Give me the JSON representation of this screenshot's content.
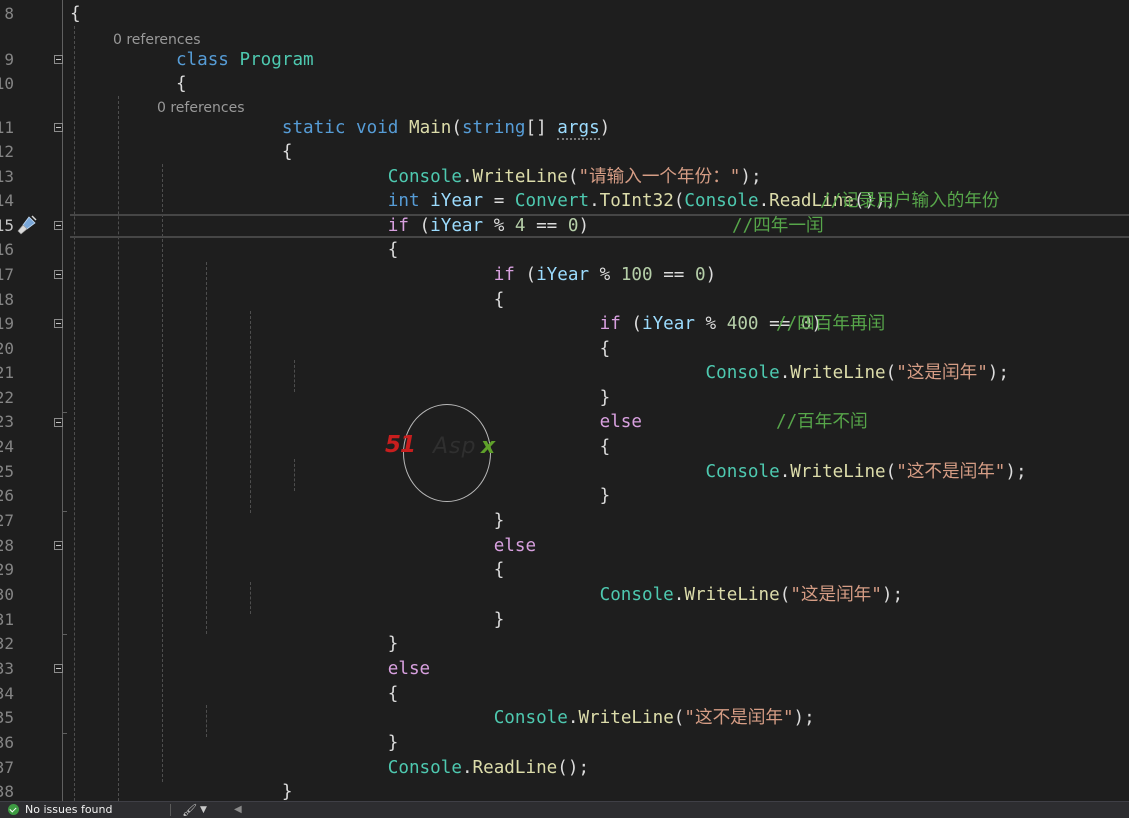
{
  "editor": {
    "current_line": "15",
    "line_numbers": [
      "8",
      "9",
      "10",
      "11",
      "12",
      "13",
      "14",
      "15",
      "16",
      "17",
      "18",
      "19",
      "20",
      "21",
      "22",
      "23",
      "24",
      "25",
      "26",
      "27",
      "28",
      "29",
      "30",
      "31",
      "32",
      "33",
      "34",
      "35",
      "36",
      "37",
      "38"
    ],
    "codelens": [
      "0 references",
      "0 references"
    ],
    "code": {
      "l8_brace": "{",
      "l9_kw": "class",
      "l9_name": "Program",
      "l10_brace": "{",
      "l11_kw1": "static",
      "l11_kw2": "void",
      "l11_method": "Main",
      "l11_open": "(",
      "l11_type": "string",
      "l11_arr": "[] ",
      "l11_param": "args",
      "l11_close": ")",
      "l12_brace": "{",
      "l13_cls": "Console",
      "l13_dot": ".",
      "l13_method": "WriteLine",
      "l13_open": "(",
      "l13_str": "\"请输入一个年份：\"",
      "l13_close": ");",
      "l14_kw": "int",
      "l14_var": "iYear",
      "l14_eq": " = ",
      "l14_cls": "Convert",
      "l14_dot": ".",
      "l14_method": "ToInt32",
      "l14_open": "(",
      "l14_cls2": "Console",
      "l14_dot2": ".",
      "l14_method2": "ReadLine",
      "l14_close": "());",
      "l14_comment": "//记录用户输入的年份",
      "l15_kw": "if",
      "l15_open": " (",
      "l15_var": "iYear",
      "l15_op": " % ",
      "l15_n1": "4",
      "l15_eq": " == ",
      "l15_n2": "0",
      "l15_close": ")",
      "l15_comment": "//四年一闰",
      "l16_brace": "{",
      "l17_kw": "if",
      "l17_open": " (",
      "l17_var": "iYear",
      "l17_op": " % ",
      "l17_n1": "100",
      "l17_eq": " == ",
      "l17_n2": "0",
      "l17_close": ")",
      "l18_brace": "{",
      "l19_kw": "if",
      "l19_open": " (",
      "l19_var": "iYear",
      "l19_op": " % ",
      "l19_n1": "400",
      "l19_eq": " == ",
      "l19_n2": "0",
      "l19_close": ")",
      "l19_comment": "//四百年再闰",
      "l20_brace": "{",
      "l21_cls": "Console",
      "l21_dot": ".",
      "l21_method": "WriteLine",
      "l21_open": "(",
      "l21_str": "\"这是闰年\"",
      "l21_close": ");",
      "l22_brace": "}",
      "l23_kw": "else",
      "l23_comment": "//百年不闰",
      "l24_brace": "{",
      "l25_cls": "Console",
      "l25_dot": ".",
      "l25_method": "WriteLine",
      "l25_open": "(",
      "l25_str": "\"这不是闰年\"",
      "l25_close": ");",
      "l26_brace": "}",
      "l27_brace": "}",
      "l28_kw": "else",
      "l29_brace": "{",
      "l30_cls": "Console",
      "l30_dot": ".",
      "l30_method": "WriteLine",
      "l30_open": "(",
      "l30_str": "\"这是闰年\"",
      "l30_close": ");",
      "l31_brace": "}",
      "l32_brace": "}",
      "l33_kw": "else",
      "l34_brace": "{",
      "l35_cls": "Console",
      "l35_dot": ".",
      "l35_method": "WriteLine",
      "l35_open": "(",
      "l35_str": "\"这不是闰年\"",
      "l35_close": ");",
      "l36_brace": "}",
      "l37_cls": "Console",
      "l37_dot": ".",
      "l37_method": "ReadLine",
      "l37_close": "();",
      "l38_brace": "}"
    }
  },
  "watermark": {
    "part1": "51",
    "part2": "Asp",
    "part3": "x"
  },
  "statusbar": {
    "issues": "No issues found",
    "icons": [
      "check-circle-icon",
      "brush-icon",
      "chevron-down-icon",
      "scroll-left-icon"
    ]
  },
  "colors": {
    "background": "#1e1e1e",
    "keyword": "#569cd6",
    "control": "#d8a0df",
    "type": "#4ec9b0",
    "method": "#dcdcaa",
    "variable": "#9cdcfe",
    "string": "#d69d85",
    "number": "#b5cea8",
    "comment": "#57a64a"
  }
}
